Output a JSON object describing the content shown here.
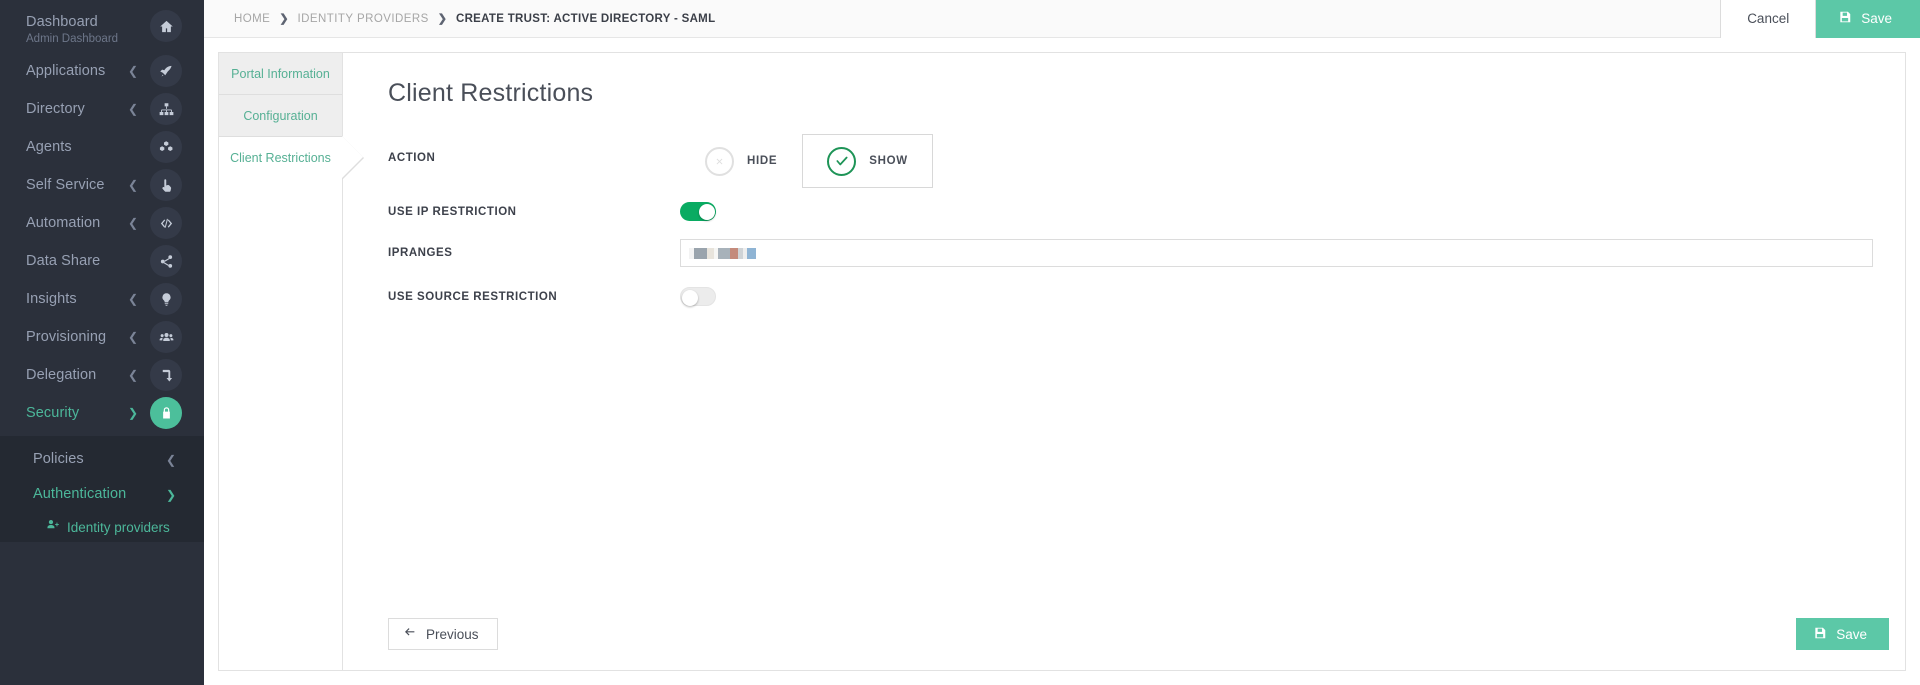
{
  "sidebar": {
    "items": [
      {
        "label": "Dashboard",
        "sub": "Admin Dashboard",
        "icon": "home-icon",
        "chevron": "",
        "active": false,
        "circle": "dark"
      },
      {
        "label": "Applications",
        "sub": "",
        "icon": "rocket-icon",
        "chevron": "left",
        "active": false,
        "circle": "dark"
      },
      {
        "label": "Directory",
        "sub": "",
        "icon": "sitemap-icon",
        "chevron": "left",
        "active": false,
        "circle": "dark"
      },
      {
        "label": "Agents",
        "sub": "",
        "icon": "cubes-icon",
        "chevron": "",
        "active": false,
        "circle": "dark"
      },
      {
        "label": "Self Service",
        "sub": "",
        "icon": "hand-pointer-icon",
        "chevron": "left",
        "active": false,
        "circle": "dark"
      },
      {
        "label": "Automation",
        "sub": "",
        "icon": "code-icon",
        "chevron": "left",
        "active": false,
        "circle": "dark"
      },
      {
        "label": "Data Share",
        "sub": "",
        "icon": "share-icon",
        "chevron": "",
        "active": false,
        "circle": "dark"
      },
      {
        "label": "Insights",
        "sub": "",
        "icon": "lightbulb-icon",
        "chevron": "left",
        "active": false,
        "circle": "dark"
      },
      {
        "label": "Provisioning",
        "sub": "",
        "icon": "users-icon",
        "chevron": "left",
        "active": false,
        "circle": "dark"
      },
      {
        "label": "Delegation",
        "sub": "",
        "icon": "arrow-turn-down-icon",
        "chevron": "left",
        "active": false,
        "circle": "dark"
      },
      {
        "label": "Security",
        "sub": "",
        "icon": "lock-icon",
        "chevron": "down",
        "active": true,
        "circle": "green"
      }
    ],
    "submenu": [
      {
        "label": "Policies",
        "chevron": "left",
        "active": false
      },
      {
        "label": "Authentication",
        "chevron": "down",
        "active": true
      }
    ],
    "leaf": {
      "label": "Identity providers",
      "icon": "user-plus-icon"
    },
    "accent_color": "#4cb79a"
  },
  "topbar": {
    "breadcrumb": [
      {
        "label": "HOME",
        "current": false
      },
      {
        "label": "IDENTITY PROVIDERS",
        "current": false
      },
      {
        "label": "CREATE TRUST: ACTIVE DIRECTORY - SAML",
        "current": true
      }
    ],
    "separator": "❯",
    "cancel_label": "Cancel",
    "save_label": "Save",
    "save_icon": "save-icon",
    "save_color": "#5cc8a7"
  },
  "tabs": [
    {
      "label": "Portal Information",
      "active": false
    },
    {
      "label": "Configuration",
      "active": false
    },
    {
      "label": "Client Restrictions",
      "active": true
    }
  ],
  "form": {
    "title": "Client Restrictions",
    "action": {
      "label": "ACTION",
      "options": [
        {
          "label": "HIDE",
          "selected": false,
          "icon": "x-circle-icon"
        },
        {
          "label": "SHOW",
          "selected": true,
          "icon": "check-circle-icon"
        }
      ],
      "selected_color": "#1e9457"
    },
    "fields": [
      {
        "label": "USE IP RESTRICTION",
        "type": "toggle",
        "value": "on"
      },
      {
        "label": "IPRANGES",
        "type": "text",
        "value": "",
        "redacted": true
      },
      {
        "label": "USE SOURCE RESTRICTION",
        "type": "toggle",
        "value": "off"
      }
    ],
    "toggle_on_color": "#09ab62",
    "toggle_off_color": "#ececec"
  },
  "footer": {
    "previous_label": "Previous",
    "previous_icon": "arrow-left-icon",
    "save_label": "Save",
    "save_icon": "save-icon"
  }
}
